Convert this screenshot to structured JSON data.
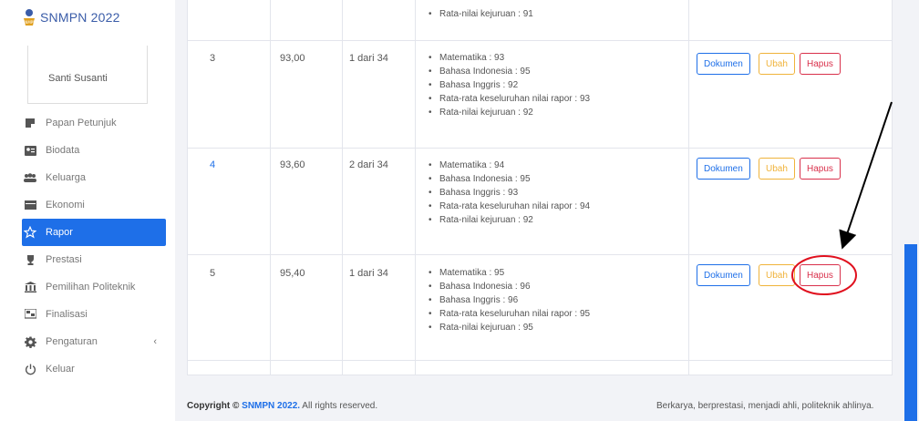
{
  "brand": {
    "name": "SNMPN 2022"
  },
  "user": {
    "name": "Santi Susanti"
  },
  "nav": [
    {
      "label": "Papan Petunjuk",
      "icon": "dashboard-icon"
    },
    {
      "label": "Biodata",
      "icon": "id-card-icon"
    },
    {
      "label": "Keluarga",
      "icon": "users-icon"
    },
    {
      "label": "Ekonomi",
      "icon": "money-icon"
    },
    {
      "label": "Rapor",
      "icon": "star-icon",
      "active": true
    },
    {
      "label": "Prestasi",
      "icon": "trophy-icon"
    },
    {
      "label": "Pemilihan Politeknik",
      "icon": "building-icon"
    },
    {
      "label": "Finalisasi",
      "icon": "flag-icon"
    },
    {
      "label": "Pengaturan",
      "icon": "gear-icon",
      "chevron": "‹"
    },
    {
      "label": "Keluar",
      "icon": "power-icon"
    }
  ],
  "rows": [
    {
      "details": [
        "Rata-nilai kejuruan : 91"
      ]
    },
    {
      "no": "3",
      "avg": "93,00",
      "rank": "1 dari 34",
      "details": [
        "Matematika : 93",
        "Bahasa Indonesia : 95",
        "Bahasa Inggris : 92",
        "Rata-rata keseluruhan nilai rapor : 93",
        "Rata-nilai kejuruan : 92"
      ]
    },
    {
      "no": "4",
      "avg": "93,60",
      "rank": "2 dari 34",
      "details": [
        "Matematika : 94",
        "Bahasa Indonesia : 95",
        "Bahasa Inggris : 93",
        "Rata-rata keseluruhan nilai rapor : 94",
        "Rata-nilai kejuruan : 92"
      ]
    },
    {
      "no": "5",
      "avg": "95,40",
      "rank": "1 dari 34",
      "details": [
        "Matematika : 95",
        "Bahasa Indonesia : 96",
        "Bahasa Inggris : 96",
        "Rata-rata keseluruhan nilai rapor : 95",
        "Rata-nilai kejuruan : 95"
      ]
    }
  ],
  "buttons": {
    "dokumen": "Dokumen",
    "ubah": "Ubah",
    "hapus": "Hapus"
  },
  "footer": {
    "copyright_prefix": "Copyright © ",
    "copyright_brand": "SNMPN 2022.",
    "copyright_suffix": " All rights reserved.",
    "tagline": "Berkarya, berprestasi, menjadi ahli, politeknik ahlinya."
  },
  "colors": {
    "primary": "#1e6fe8",
    "warning": "#f0b33a",
    "danger": "#d9304b",
    "annotation": "#e0101e"
  }
}
